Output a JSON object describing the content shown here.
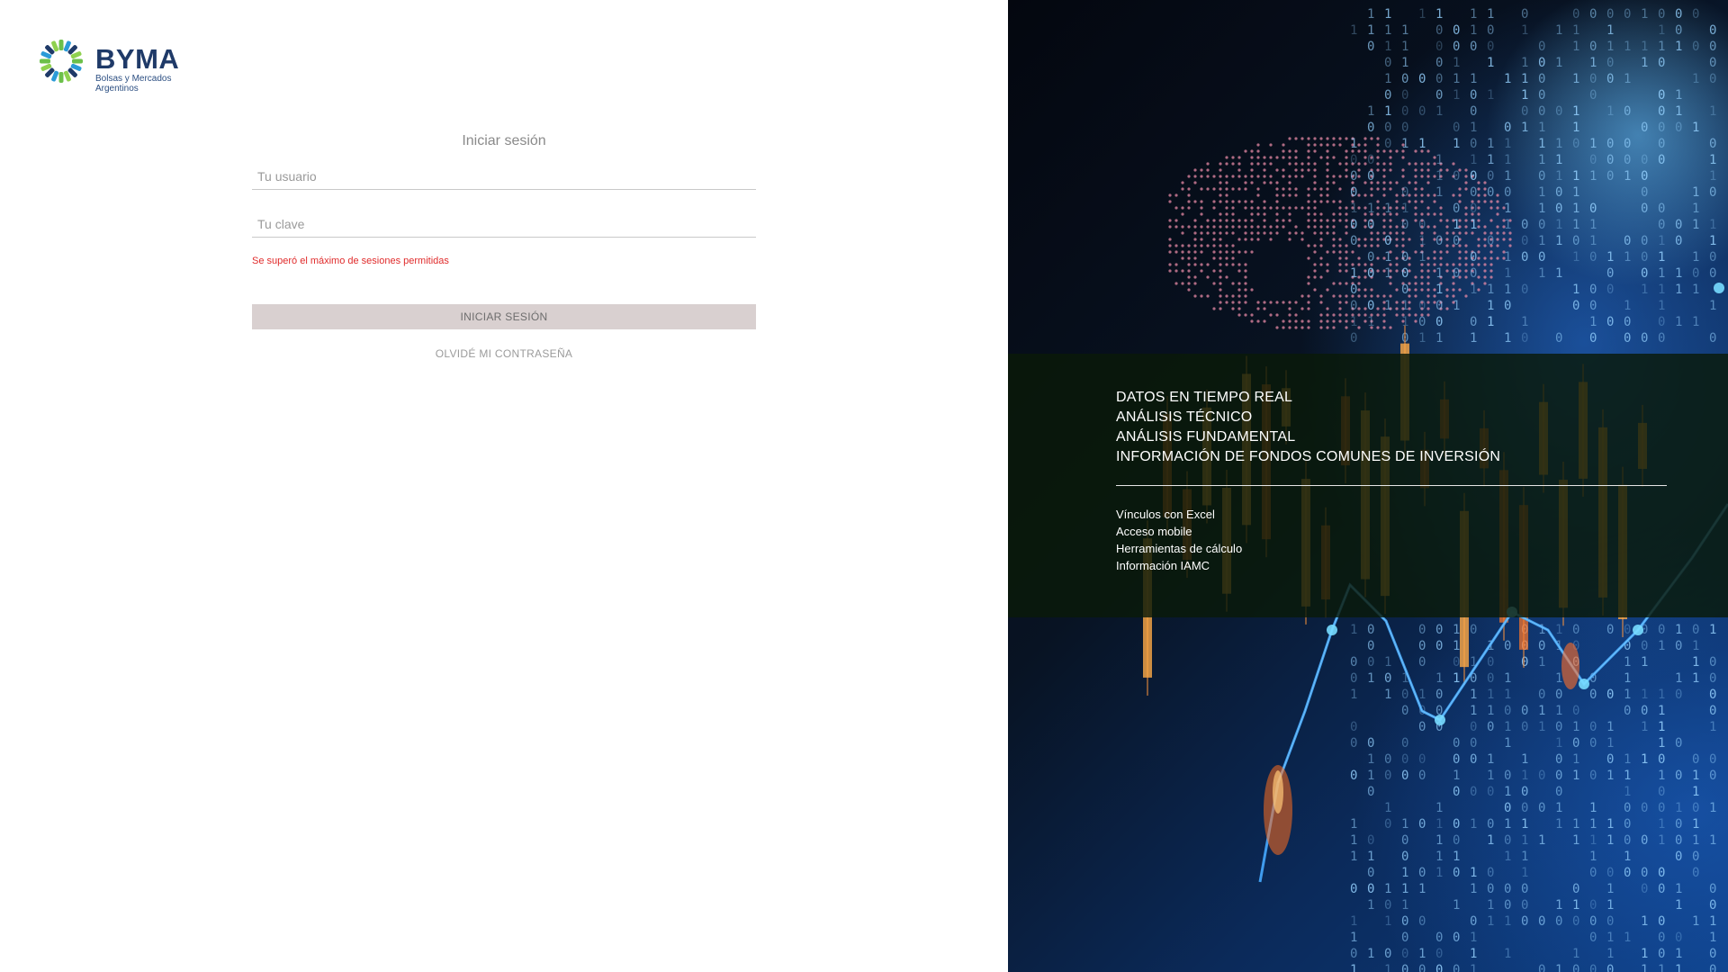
{
  "brand": {
    "name": "BYMA",
    "tagline_line1": "Bolsas y Mercados",
    "tagline_line2": "Argentinos",
    "colors": {
      "primary": "#1f3a68",
      "accent_green": "#6cc04a",
      "accent_blue": "#2b9bd8"
    }
  },
  "login": {
    "title": "Iniciar sesión",
    "username_placeholder": "Tu usuario",
    "username_value": "",
    "password_placeholder": "Tu clave",
    "password_value": "",
    "error_message": "Se superó el máximo de sesiones permitidas",
    "submit_label": "INICIAR SESIÓN",
    "forgot_label": "OLVIDÉ MI CONTRASEÑA"
  },
  "promo": {
    "headlines": [
      "DATOS EN TIEMPO REAL",
      "ANÁLISIS TÉCNICO",
      "ANÁLISIS FUNDAMENTAL",
      "INFORMACIÓN DE FONDOS COMUNES DE INVERSIÓN"
    ],
    "features": [
      "Vínculos con Excel",
      "Acceso mobile",
      "Herramientas de cálculo",
      "Información IAMC"
    ]
  },
  "colors": {
    "error": "#e02b2b",
    "button_bg": "#d9d0d0",
    "band_bg": "#0a1a08",
    "error_text": "#e02b2b"
  }
}
